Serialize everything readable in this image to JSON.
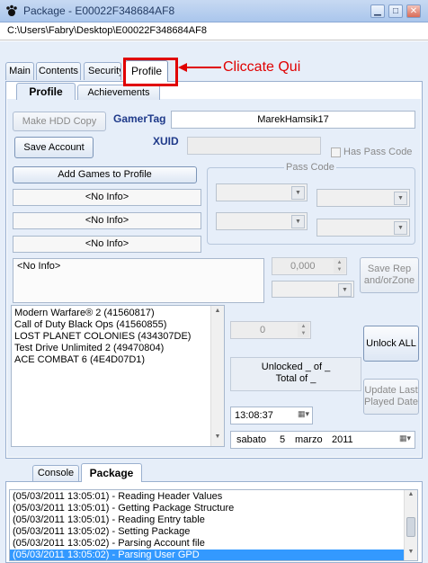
{
  "window": {
    "title": "Package - E00022F348684AF8",
    "path": "C:\\Users\\Fabry\\Desktop\\E00022F348684AF8"
  },
  "main_tabs": [
    "Main",
    "Contents",
    "Security",
    "Profile"
  ],
  "annotation": {
    "text": "Cliccate Qui",
    "color": "#e00000"
  },
  "profile_tabs": [
    "Profile",
    "Achievements"
  ],
  "profile": {
    "make_hdd_copy": "Make HDD Copy",
    "gamertag_label": "GamerTag",
    "gamertag_value": "MarekHamsik17",
    "save_account": "Save Account",
    "xuid_label": "XUID",
    "xuid_value": "",
    "has_pass_code": "Has Pass Code",
    "pass_code_label": "Pass Code",
    "add_games": "Add Games to Profile",
    "info_rows": [
      "<No Info>",
      "<No Info>",
      "<No Info>"
    ],
    "no_info_text": "<No Info>",
    "numeric_value": "0,000",
    "save_rep": "Save Rep and/orZone",
    "games": [
      "Modern Warfare® 2 (41560817)",
      "Call of Duty Black Ops (41560855)",
      "LOST PLANET COLONIES (434307DE)",
      "Test Drive Unlimited 2 (49470804)",
      "ACE COMBAT 6 (4E4D07D1)"
    ],
    "achievement_count": "0",
    "unlocked_text": "Unlocked _ of _",
    "total_text": "Total of _",
    "unlock_all": "Unlock ALL",
    "update_last_played": "Update Last Played Date",
    "time_value": "13:08:37",
    "date": {
      "weekday": "sabato",
      "day": "5",
      "month": "marzo",
      "year": "2011"
    }
  },
  "bottom_tabs": [
    "Console",
    "Package"
  ],
  "log": [
    "(05/03/2011 13:05:01) - Reading Header Values",
    "(05/03/2011 13:05:01) - Getting Package Structure",
    "(05/03/2011 13:05:01) - Reading Entry table",
    "(05/03/2011 13:05:02) - Setting Package",
    "(05/03/2011 13:05:02) - Parsing Account file",
    "(05/03/2011 13:05:02) - Parsing User GPD"
  ],
  "colors": {
    "accent": "#1f3a8a",
    "selection": "#3399ff",
    "panel": "#e6eef9"
  }
}
